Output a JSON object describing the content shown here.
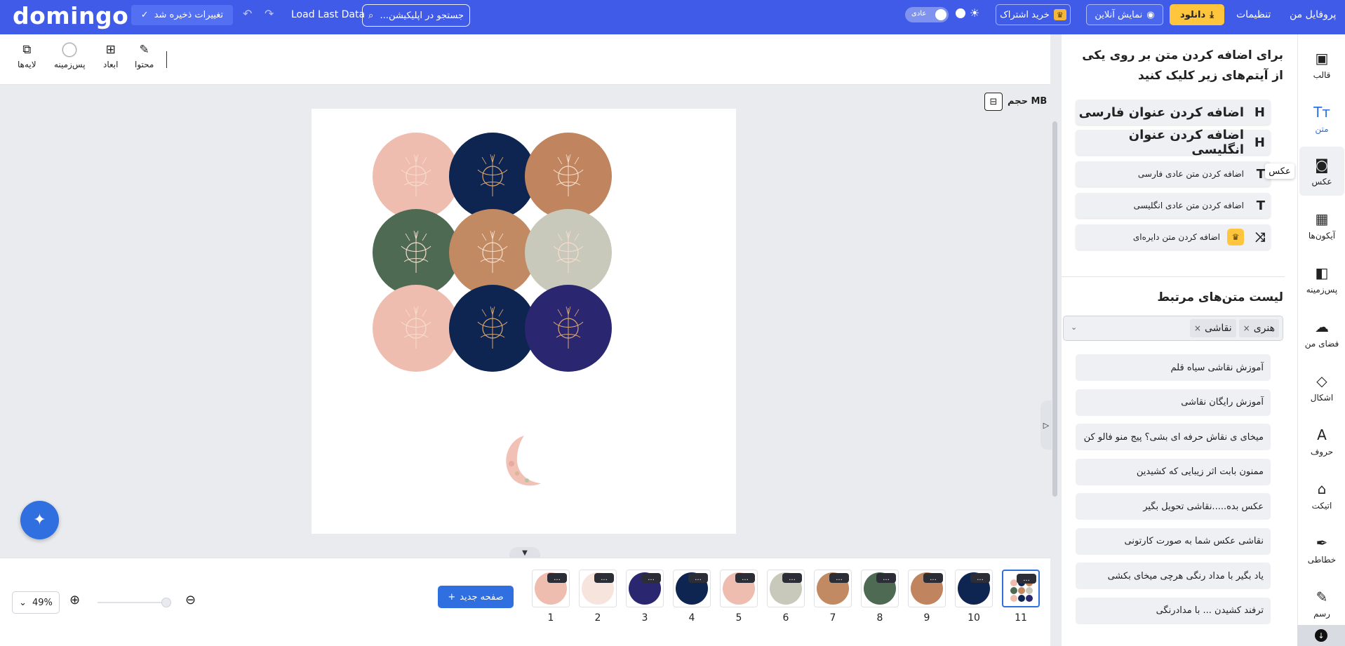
{
  "topbar": {
    "logo": "domingo",
    "save_label": "تغییرات ذخیره شد",
    "load_last": "Load Last Data",
    "search_placeholder": "جستجو در اپلیکیشن...",
    "mode_label": "عادی",
    "subscribe_label": "خرید اشتراک",
    "online_label": "نمایش آنلاین",
    "download_label": "دانلود",
    "settings_label": "تنظیمات",
    "profile_label": "پروفایل من"
  },
  "toolbar": {
    "layers": "لایه‌ها",
    "background": "پس‌زمینه",
    "dimensions": "ابعاد",
    "content": "محتوا"
  },
  "canvas": {
    "size_label": "حجم MB",
    "circle_colors": [
      "#efbdb0",
      "#0d2550",
      "#c0855e",
      "#4e6a53",
      "#c28a63",
      "#c8c9ba",
      "#efbdb0",
      "#0d2550",
      "#2a2770"
    ]
  },
  "bottom": {
    "zoom": "49%",
    "new_page": "صفحه جدید",
    "more_label": "...",
    "pages": [
      {
        "num": "1",
        "color": "#efbdb0"
      },
      {
        "num": "2",
        "color": "#f7e4dc"
      },
      {
        "num": "3",
        "color": "#2a2770"
      },
      {
        "num": "4",
        "color": "#0d2550"
      },
      {
        "num": "5",
        "color": "#efbdb0"
      },
      {
        "num": "6",
        "color": "#c8c9ba"
      },
      {
        "num": "7",
        "color": "#c28a63"
      },
      {
        "num": "8",
        "color": "#4e6a53"
      },
      {
        "num": "9",
        "color": "#c0855e"
      },
      {
        "num": "10",
        "color": "#0d2550"
      },
      {
        "num": "11",
        "color": "#ffffff"
      }
    ]
  },
  "panel": {
    "title": "برای اضافه کردن متن بر روی یکی از آیتم‌های زیر کلیک کنید",
    "add_buttons": [
      {
        "label": "اضافه کردن عنوان فارسی",
        "icon": "H",
        "size": "big"
      },
      {
        "label": "اضافه کردن عنوان انگلیسی",
        "icon": "H",
        "size": "big"
      },
      {
        "label": "اضافه کردن متن عادی فارسی",
        "icon": "T",
        "size": "small"
      },
      {
        "label": "اضافه کردن متن عادی انگلیسی",
        "icon": "T",
        "size": "small"
      },
      {
        "label": "اضافه کردن متن دایره‌ای",
        "icon": "⤨",
        "size": "small"
      }
    ],
    "related_title": "لیست متن‌های مرتبط",
    "tags": [
      "هنری",
      "نقاشی"
    ],
    "tag_remove": "×",
    "items": [
      "آموزش نقاشی سیاه قلم",
      "آموزش رایگان نقاشی",
      "میخای ی نقاش حرفه ای بشی؟ پیج منو فالو کن",
      "ممنون بابت اثر زیبایی که کشیدین",
      "عکس بده.....نقاشی تحویل بگیر",
      "نقاشی عکس شما به صورت کارتونی",
      "یاد بگیر با مداد رنگی هرچی میخای بکشی",
      "ترفند کشیدن ... با مدادرنگی"
    ],
    "tooltip": "عکس"
  },
  "nav": [
    {
      "label": "قالب",
      "icon": "▣"
    },
    {
      "label": "متن",
      "icon": "Tт"
    },
    {
      "label": "عکس",
      "icon": "◙"
    },
    {
      "label": "آیکون‌ها",
      "icon": "▦"
    },
    {
      "label": "پس‌زمینه",
      "icon": "◧"
    },
    {
      "label": "فضای من",
      "icon": "☁"
    },
    {
      "label": "اشکال",
      "icon": "◇"
    },
    {
      "label": "حروف",
      "icon": "A"
    },
    {
      "label": "اتیکت",
      "icon": "⌂"
    },
    {
      "label": "خطاطی",
      "icon": "✒"
    },
    {
      "label": "رسم",
      "icon": "✎"
    }
  ]
}
